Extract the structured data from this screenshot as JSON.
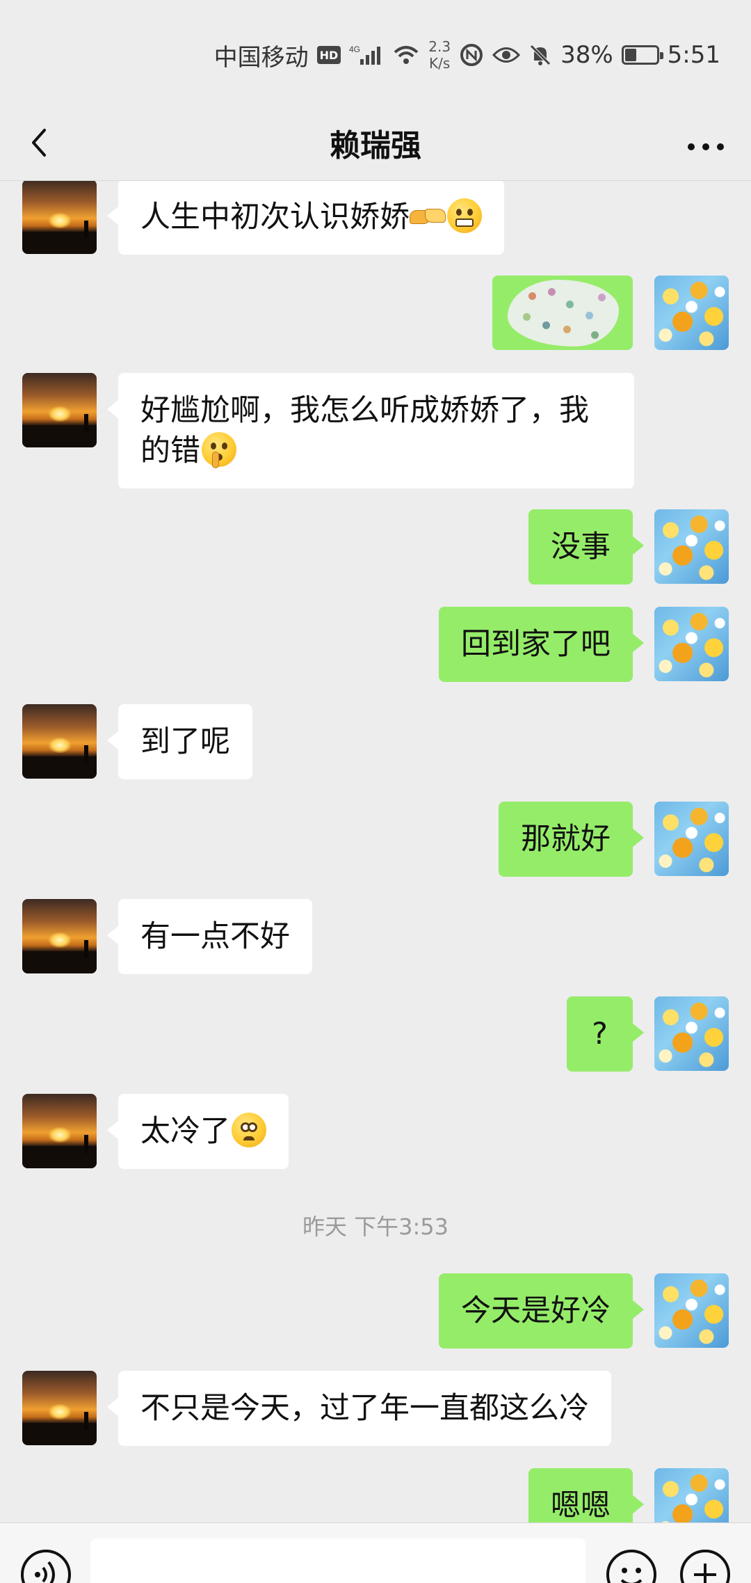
{
  "status_bar": {
    "carrier": "中国移动",
    "hd": "HD",
    "network": "4G",
    "net_speed_value": "2.3",
    "net_speed_unit": "K/s",
    "battery_percent": "38%",
    "battery_level": 0.38,
    "time": "5:51"
  },
  "header": {
    "title": "赖瑞强",
    "back_icon": "chevron-left-icon",
    "more_icon": "more-dots-icon"
  },
  "messages": [
    {
      "side": "recv",
      "text": "人生中初次认识娇娇",
      "emoji": [
        "handshake-emoji",
        "grin-emoji"
      ]
    },
    {
      "side": "sent",
      "type": "sticker"
    },
    {
      "side": "recv",
      "text": "好尴尬啊，我怎么听成娇娇了，我的错",
      "emoji": [
        "shushing-emoji"
      ]
    },
    {
      "side": "sent",
      "text": "没事"
    },
    {
      "side": "sent",
      "text": "回到家了吧"
    },
    {
      "side": "recv",
      "text": "到了呢"
    },
    {
      "side": "sent",
      "text": "那就好"
    },
    {
      "side": "recv",
      "text": "有一点不好"
    },
    {
      "side": "sent",
      "text": "?"
    },
    {
      "side": "recv",
      "text": "太冷了",
      "emoji": [
        "pleading-emoji"
      ]
    },
    {
      "type": "timestamp",
      "text": "昨天 下午3:53"
    },
    {
      "side": "sent",
      "text": "今天是好冷"
    },
    {
      "side": "recv",
      "text": "不只是今天，过了年一直都这么冷"
    },
    {
      "side": "sent",
      "text": "嗯嗯"
    }
  ],
  "input_bar": {
    "voice_icon": "voice-icon",
    "emoji_icon": "emoji-face-icon",
    "plus_icon": "plus-icon",
    "input_value": ""
  },
  "colors": {
    "background": "#ededed",
    "sent_bubble": "#95ec69",
    "recv_bubble": "#ffffff",
    "timestamp_text": "#9a9a9a"
  }
}
